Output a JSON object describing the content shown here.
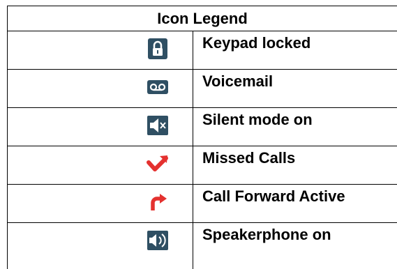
{
  "legend": {
    "title": "Icon Legend",
    "rows": [
      {
        "icon": "lock-icon",
        "label": "Keypad locked"
      },
      {
        "icon": "voicemail-icon",
        "label": "Voicemail"
      },
      {
        "icon": "mute-icon",
        "label": "Silent mode on"
      },
      {
        "icon": "missed-call-icon",
        "label": "Missed Calls"
      },
      {
        "icon": "call-forward-icon",
        "label": "Call Forward Active"
      },
      {
        "icon": "speaker-icon",
        "label": "Speakerphone on"
      }
    ]
  },
  "colors": {
    "icon_dark": "#2f4f63",
    "icon_red": "#e4312f"
  }
}
